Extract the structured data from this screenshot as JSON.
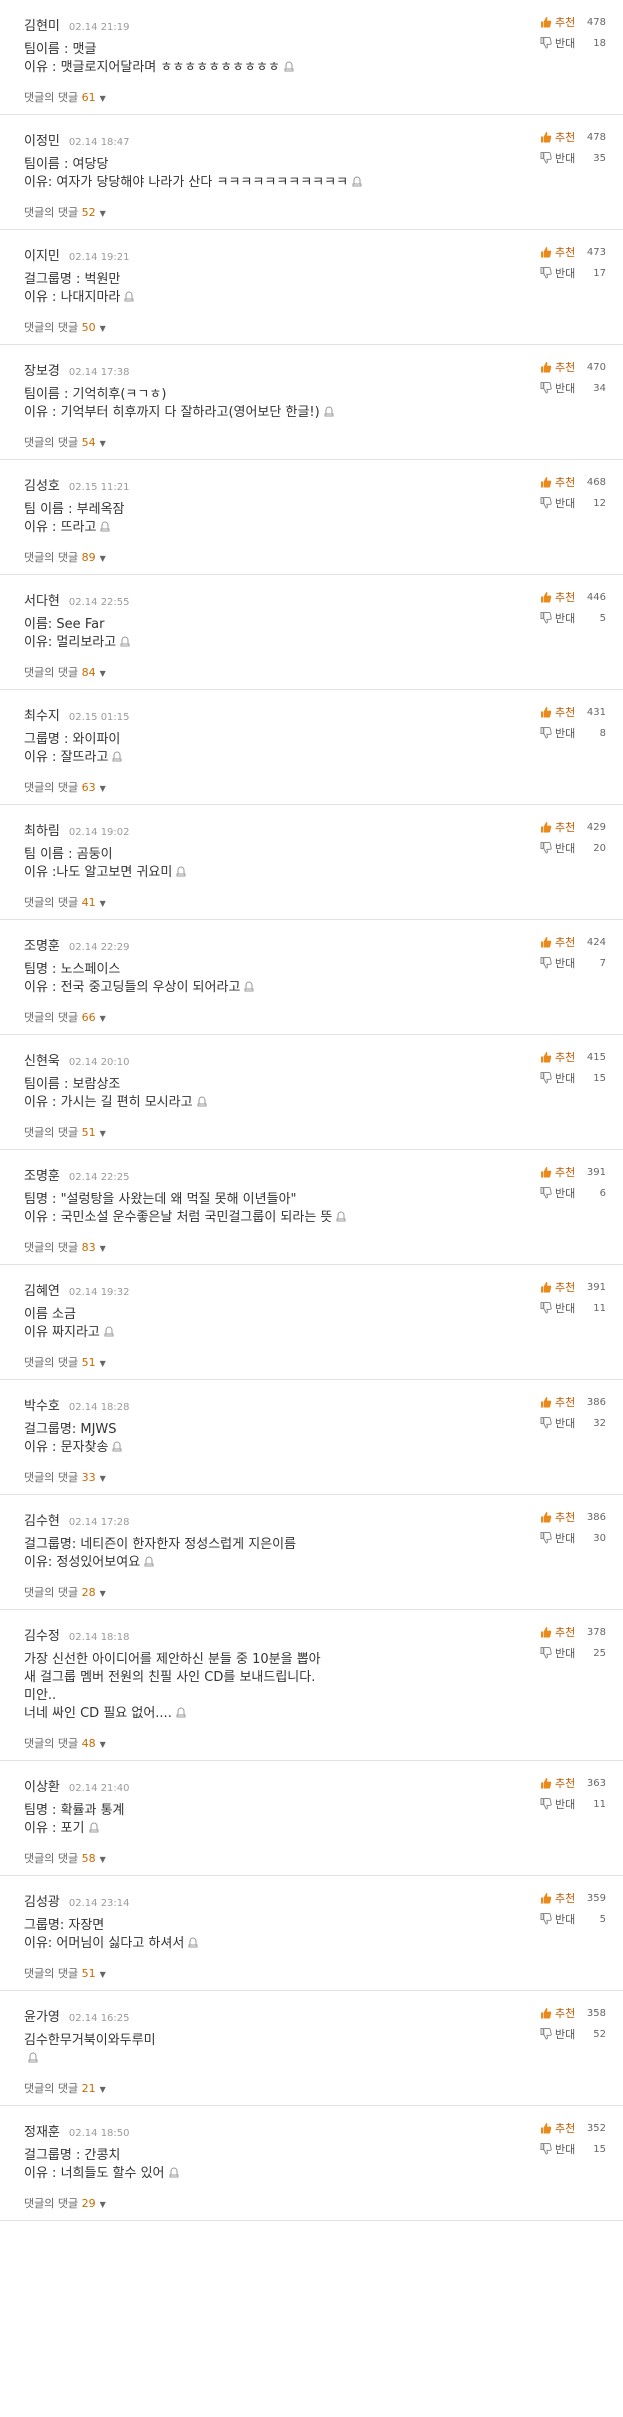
{
  "labels": {
    "up": "추천",
    "down": "반대",
    "replies_prefix": "댓글의 댓글"
  },
  "colors": {
    "up_label": "#c35a00",
    "reply_count": "#c96a00",
    "divider": "#e2e2e2"
  },
  "icons": {
    "up": "thumbs-up-icon",
    "down": "thumbs-down-icon",
    "report": "report-icon",
    "expand": "chevron-down-icon"
  },
  "comments": [
    {
      "author": "김현미",
      "time": "02.14 21:19",
      "lines": [
        {
          "text": "팀이름 : 맷글"
        },
        {
          "text": "이유 : 맷글로지어달라며 ㅎㅎㅎㅎㅎㅎㅎㅎㅎㅎ",
          "report": true
        }
      ],
      "replies": "61",
      "up": "478",
      "down": "18"
    },
    {
      "author": "이정민",
      "time": "02.14 18:47",
      "lines": [
        {
          "text": "팀이름 : 여당당"
        },
        {
          "text": "이유: 여자가 당당해야 나라가 산다 ㅋㅋㅋㅋㅋㅋㅋㅋㅋㅋㅋ",
          "report": true
        }
      ],
      "replies": "52",
      "up": "478",
      "down": "35"
    },
    {
      "author": "이지민",
      "time": "02.14 19:21",
      "lines": [
        {
          "text": "걸그룹명 : 벅원만"
        },
        {
          "text": "이유 : 나대지마라",
          "report": true
        }
      ],
      "replies": "50",
      "up": "473",
      "down": "17"
    },
    {
      "author": "장보경",
      "time": "02.14 17:38",
      "lines": [
        {
          "text": "팀이름 : 기억히후(ㅋㄱㅎ)"
        },
        {
          "text": "이유 : 기억부터 히후까지 다 잘하라고(영어보단 한글!)",
          "report": true
        }
      ],
      "replies": "54",
      "up": "470",
      "down": "34"
    },
    {
      "author": "김성호",
      "time": "02.15 11:21",
      "lines": [
        {
          "text": "팀 이름 : 부레옥잠"
        },
        {
          "text": "이유 : 뜨라고",
          "report": true
        }
      ],
      "replies": "89",
      "up": "468",
      "down": "12"
    },
    {
      "author": "서다현",
      "time": "02.14 22:55",
      "lines": [
        {
          "text": "이름: See Far"
        },
        {
          "text": "이유: 멀리보라고",
          "report": true
        }
      ],
      "replies": "84",
      "up": "446",
      "down": "5"
    },
    {
      "author": "최수지",
      "time": "02.15 01:15",
      "lines": [
        {
          "text": "그룹명 : 와이파이"
        },
        {
          "text": "이유 : 잘뜨라고",
          "report": true
        }
      ],
      "replies": "63",
      "up": "431",
      "down": "8"
    },
    {
      "author": "최하림",
      "time": "02.14 19:02",
      "lines": [
        {
          "text": "팀 이름 : 곰둥이"
        },
        {
          "text": "이유 :나도 알고보면 귀요미",
          "report": true
        }
      ],
      "replies": "41",
      "up": "429",
      "down": "20"
    },
    {
      "author": "조명훈",
      "time": "02.14 22:29",
      "lines": [
        {
          "text": "팀명 : 노스페이스"
        },
        {
          "text": "이유 : 전국 중고딩들의 우상이 되어라고",
          "report": true
        }
      ],
      "replies": "66",
      "up": "424",
      "down": "7"
    },
    {
      "author": "신현욱",
      "time": "02.14 20:10",
      "lines": [
        {
          "text": "팀이름 : 보람상조"
        },
        {
          "text": "이유 : 가시는 길 편히 모시라고",
          "report": true
        }
      ],
      "replies": "51",
      "up": "415",
      "down": "15"
    },
    {
      "author": "조명훈",
      "time": "02.14 22:25",
      "lines": [
        {
          "text": "팀명 : \"설렁탕을 사왔는데 왜 먹질 못해 이년들아\""
        },
        {
          "text": "이유 : 국민소설 운수좋은날 처럼 국민걸그룹이 되라는 뜻",
          "report": true
        }
      ],
      "replies": "83",
      "up": "391",
      "down": "6"
    },
    {
      "author": "김혜연",
      "time": "02.14 19:32",
      "lines": [
        {
          "text": "이름 소금"
        },
        {
          "text": "이유 짜지라고",
          "report": true
        }
      ],
      "replies": "51",
      "up": "391",
      "down": "11"
    },
    {
      "author": "박수호",
      "time": "02.14 18:28",
      "lines": [
        {
          "text": "걸그룹명: MJWS"
        },
        {
          "text": "이유 : 문자찾송",
          "report": true
        }
      ],
      "replies": "33",
      "up": "386",
      "down": "32"
    },
    {
      "author": "김수현",
      "time": "02.14 17:28",
      "lines": [
        {
          "text": "걸그룹명: 네티즌이 한자한자 정성스럽게 지은이름"
        },
        {
          "text": "이유: 정성있어보여요",
          "report": true
        }
      ],
      "replies": "28",
      "up": "386",
      "down": "30"
    },
    {
      "author": "김수정",
      "time": "02.14 18:18",
      "lines": [
        {
          "text": "가장 신선한 아이디어를 제안하신 분들 중 10분을 뽑아"
        },
        {
          "text": "새 걸그룹 멤버 전원의 친필 사인 CD를 보내드립니다."
        },
        {
          "text": "미안.."
        },
        {
          "text": "너네 싸인 CD 필요 없어....",
          "report": true
        }
      ],
      "replies": "48",
      "up": "378",
      "down": "25"
    },
    {
      "author": "이상환",
      "time": "02.14 21:40",
      "lines": [
        {
          "text": "팀명 : 확률과 통계"
        },
        {
          "text": "이유 : 포기",
          "report": true
        }
      ],
      "replies": "58",
      "up": "363",
      "down": "11"
    },
    {
      "author": "김성광",
      "time": "02.14 23:14",
      "lines": [
        {
          "text": "그룹명: 자장면"
        },
        {
          "text": "이유: 어머님이 싫다고 하셔서",
          "report": true
        }
      ],
      "replies": "51",
      "up": "359",
      "down": "5"
    },
    {
      "author": "윤가영",
      "time": "02.14 16:25",
      "lines": [
        {
          "text": "김수한무거북이와두루미"
        },
        {
          "text": "",
          "report": true
        }
      ],
      "replies": "21",
      "up": "358",
      "down": "52"
    },
    {
      "author": "정재훈",
      "time": "02.14 18:50",
      "lines": [
        {
          "text": "걸그룹명 : 간콩치"
        },
        {
          "text": "이유 : 너희들도 할수 있어",
          "report": true
        }
      ],
      "replies": "29",
      "up": "352",
      "down": "15"
    }
  ]
}
